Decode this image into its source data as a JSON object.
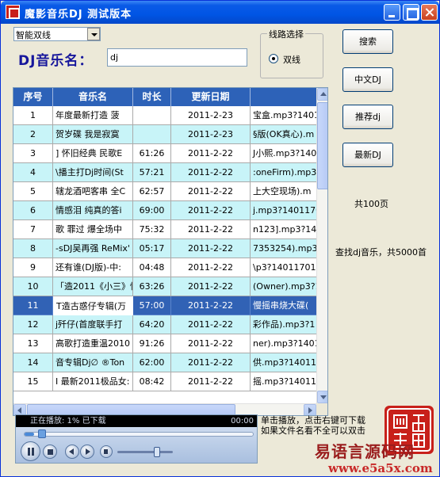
{
  "window": {
    "title": "魔影音乐DJ  测试版本",
    "controls": [
      "minimize",
      "maximize",
      "close"
    ]
  },
  "mode_select": {
    "value": "智能双线"
  },
  "search": {
    "label": "DJ音乐名：",
    "value": "dj"
  },
  "route": {
    "title": "线路选择",
    "option": "双线",
    "selected": true
  },
  "buttons": {
    "search": "搜索",
    "chinese_dj": "中文DJ",
    "recommend_dj": "推荐dj",
    "latest_dj": "最新DJ"
  },
  "total_pages": "共100页",
  "search_info": "查找dj音乐，共5000首",
  "table": {
    "headers": [
      "序号",
      "音乐名",
      "时长",
      "更新日期",
      ""
    ],
    "selected_index": 10,
    "rows": [
      {
        "no": "1",
        "name": "年度最新打造 菠",
        "duration": "",
        "date": "2011-2-23",
        "url": "宝盒.mp3?1401"
      },
      {
        "no": "2",
        "name": "贺岁碟 我是寂寞",
        "duration": "",
        "date": "2011-2-23",
        "url": "§版(OK真心).m"
      },
      {
        "no": "3",
        "name": "] 怀旧经典 民歌E",
        "duration": "61:26",
        "date": "2011-2-22",
        "url": "J小熙.mp3?140"
      },
      {
        "no": "4",
        "name": "\\播主打Dj时间(St",
        "duration": "57:21",
        "date": "2011-2-22",
        "url": ":oneFirm).mp3"
      },
      {
        "no": "5",
        "name": "辖龙酒吧客串 全C",
        "duration": "62:57",
        "date": "2011-2-22",
        "url": "上大空现场).m"
      },
      {
        "no": "6",
        "name": "情感泪 纯真的答i",
        "duration": "69:00",
        "date": "2011-2-22",
        "url": "j.mp3?1401170"
      },
      {
        "no": "7",
        "name": "歌 罪过 爆全场中",
        "duration": "75:32",
        "date": "2011-2-22",
        "url": "n123].mp3?140"
      },
      {
        "no": "8",
        "name": "-sDJ吴再强 ReMix'",
        "duration": "05:17",
        "date": "2011-2-22",
        "url": "7353254).mp3?"
      },
      {
        "no": "9",
        "name": "还有谁(DJ版)-中:",
        "duration": "04:48",
        "date": "2011-2-22",
        "url": "\\p3?1401170141"
      },
      {
        "no": "10",
        "name": "「造2011《小三》惊",
        "duration": "63:26",
        "date": "2011-2-22",
        "url": "(Owner).mp3?1"
      },
      {
        "no": "11",
        "name": "T造古惑仔专辑(万",
        "duration": "57:00",
        "date": "2011-2-22",
        "url": "慢摇串烧大碟("
      },
      {
        "no": "12",
        "name": "j歼仔(首度联手打",
        "duration": "64:20",
        "date": "2011-2-22",
        "url": "彩作品).mp3?1"
      },
      {
        "no": "13",
        "name": "高歌打造重温2010",
        "duration": "91:26",
        "date": "2011-2-22",
        "url": "ner).mp3?1401"
      },
      {
        "no": "14",
        "name": "音专辑Dj∅ ®Ton",
        "duration": "62:00",
        "date": "2011-2-22",
        "url": "供.mp3?140111"
      },
      {
        "no": "15",
        "name": "I 最新2011极品女:",
        "duration": "08:42",
        "date": "2011-2-22",
        "url": "摇.mp3?140111"
      }
    ]
  },
  "player": {
    "status": "正在播放: 1% 已下载",
    "time": "00:00",
    "progress": 0.04,
    "volume": 0.75
  },
  "hint": {
    "line1": "单击播放，点击右键可下载",
    "line2": "如果文件名看不全可以双击"
  },
  "watermark": {
    "text": "易语言源码网",
    "url": "www.e5a5x.com"
  },
  "colors": {
    "titlebar": "#0055e5",
    "header": "#2d62b8",
    "row_alt": "#c8f4f8",
    "row_selected": "#3162b5",
    "label_blue": "#17179c",
    "seal_red": "#c8201a"
  }
}
